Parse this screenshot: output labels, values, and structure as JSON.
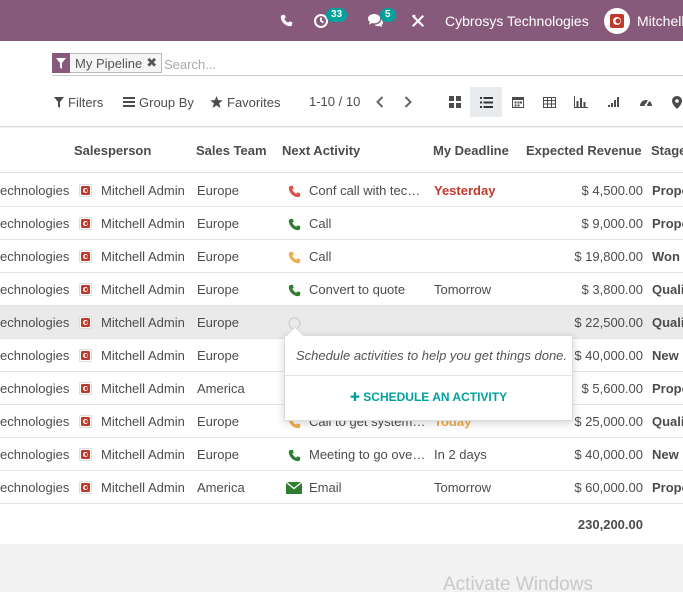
{
  "topbar": {
    "activity_badge": "33",
    "message_badge": "5",
    "company_name": "Cybrosys Technologies",
    "user_name": "Mitchell"
  },
  "search": {
    "facet_label": "My Pipeline",
    "placeholder": "Search..."
  },
  "controls": {
    "filters_label": "Filters",
    "groupby_label": "Group By",
    "favorites_label": "Favorites",
    "pager_text": "1-10 / 10"
  },
  "table": {
    "headers": {
      "salesperson": "Salesperson",
      "sales_team": "Sales Team",
      "next_activity": "Next Activity",
      "deadline": "My Deadline",
      "revenue": "Expected Revenue",
      "stage": "Stage"
    },
    "rows": [
      {
        "customer": "echnologies",
        "salesperson": "Mitchell Admin",
        "team": "Europe",
        "activity": "Conf call with tech…",
        "activity_icon": "phone-icon",
        "activity_color": "#d9534f",
        "deadline": "Yesterday",
        "deadline_style": "red",
        "revenue": "$ 4,500.00",
        "stage": "Propo"
      },
      {
        "customer": "echnologies",
        "salesperson": "Mitchell Admin",
        "team": "Europe",
        "activity": "Call",
        "activity_icon": "phone-icon",
        "activity_color": "#2e7d32",
        "deadline": "",
        "deadline_style": "",
        "revenue": "$ 9,000.00",
        "stage": "Propo"
      },
      {
        "customer": "echnologies",
        "salesperson": "Mitchell Admin",
        "team": "Europe",
        "activity": "Call",
        "activity_icon": "phone-icon",
        "activity_color": "#f0ad4e",
        "deadline": "",
        "deadline_style": "",
        "revenue": "$ 19,800.00",
        "stage": "Won"
      },
      {
        "customer": "echnologies",
        "salesperson": "Mitchell Admin",
        "team": "Europe",
        "activity": "Convert to quote",
        "activity_icon": "phone-icon",
        "activity_color": "#2e7d32",
        "deadline": "Tomorrow",
        "deadline_style": "",
        "revenue": "$ 3,800.00",
        "stage": "Quali"
      },
      {
        "customer": "echnologies",
        "salesperson": "Mitchell Admin",
        "team": "Europe",
        "activity": "",
        "activity_icon": "clock-icon",
        "activity_color": "#cccccc",
        "deadline": "",
        "deadline_style": "",
        "revenue": "$ 22,500.00",
        "stage": "Quali"
      },
      {
        "customer": "echnologies",
        "salesperson": "Mitchell Admin",
        "team": "Europe",
        "activity": "",
        "activity_icon": "",
        "activity_color": "",
        "deadline": "",
        "deadline_style": "",
        "revenue": "$ 40,000.00",
        "stage": "New"
      },
      {
        "customer": "echnologies",
        "salesperson": "Mitchell Admin",
        "team": "America",
        "activity": "",
        "activity_icon": "",
        "activity_color": "",
        "deadline": "",
        "deadline_style": "",
        "revenue": "$ 5,600.00",
        "stage": "Propo"
      },
      {
        "customer": "echnologies",
        "salesperson": "Mitchell Admin",
        "team": "Europe",
        "activity": "Call to get system …",
        "activity_icon": "phone-icon",
        "activity_color": "#f0ad4e",
        "deadline": "Today",
        "deadline_style": "orange",
        "revenue": "$ 25,000.00",
        "stage": "Quali"
      },
      {
        "customer": "echnologies",
        "salesperson": "Mitchell Admin",
        "team": "Europe",
        "activity": "Meeting to go over…",
        "activity_icon": "phone-icon",
        "activity_color": "#2e7d32",
        "deadline": "In 2 days",
        "deadline_style": "",
        "revenue": "$ 40,000.00",
        "stage": "New"
      },
      {
        "customer": "echnologies",
        "salesperson": "Mitchell Admin",
        "team": "America",
        "activity": "Email",
        "activity_icon": "envelope-icon",
        "activity_color": "#2e7d32",
        "deadline": "Tomorrow",
        "deadline_style": "",
        "revenue": "$ 60,000.00",
        "stage": "Propo"
      }
    ],
    "total_revenue": "230,200.00"
  },
  "popover": {
    "message": "Schedule activities to help you get things done.",
    "button_label": "SCHEDULE AN ACTIVITY"
  },
  "watermark": "Activate Windows",
  "colors": {
    "brand": "#875a7b",
    "accent": "#00a09d"
  }
}
